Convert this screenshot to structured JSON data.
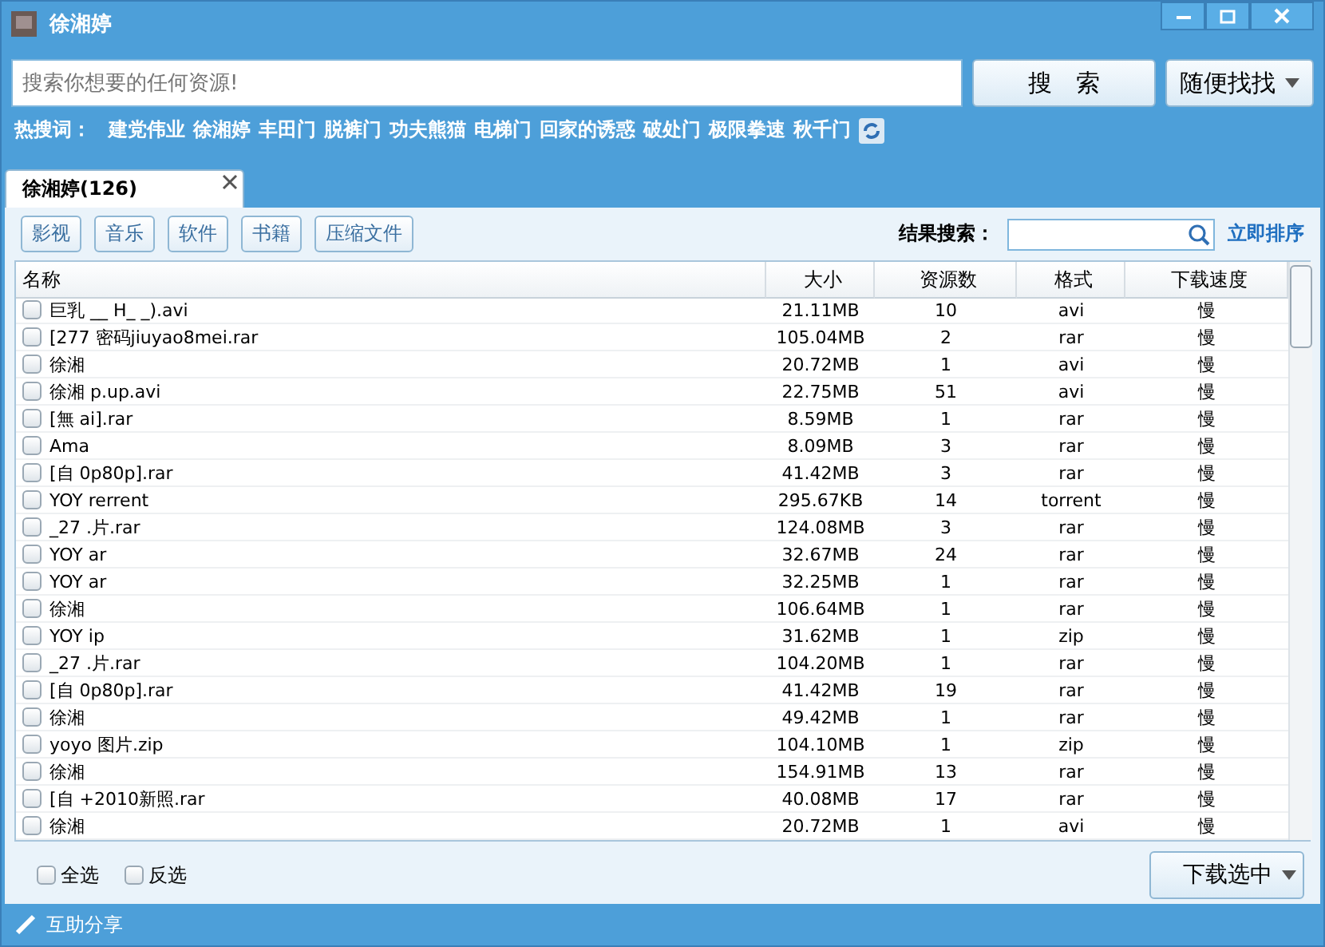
{
  "window": {
    "title": "徐湘婷"
  },
  "search": {
    "placeholder": "搜索你想要的任何资源!",
    "button": "搜　索",
    "random_button": "随便找找"
  },
  "hot_words": {
    "label": "热搜词：",
    "items": [
      "建党伟业",
      "徐湘婷",
      "丰田门",
      "脱裤门",
      "功夫熊猫",
      "电梯门",
      "回家的诱惑",
      "破处门",
      "极限拳速",
      "秋千门"
    ]
  },
  "tabs": [
    {
      "label": "徐湘婷(126)",
      "selected": true
    }
  ],
  "categories": [
    "影视",
    "音乐",
    "软件",
    "书籍",
    "压缩文件"
  ],
  "result_search": {
    "label": "结果搜索：",
    "sort_link": "立即排序"
  },
  "table": {
    "columns": [
      "名称",
      "大小",
      "资源数",
      "格式",
      "下载速度"
    ],
    "rows": [
      {
        "name": "巨乳 __ H_ _).avi",
        "size": "21.11MB",
        "count": "10",
        "format": "avi",
        "speed": "慢",
        "checked": false
      },
      {
        "name": "[277 密码jiuyao8mei.rar",
        "size": "105.04MB",
        "count": "2",
        "format": "rar",
        "speed": "慢",
        "checked": false
      },
      {
        "name": "徐湘",
        "size": "20.72MB",
        "count": "1",
        "format": "avi",
        "speed": "慢",
        "checked": false
      },
      {
        "name": "徐湘 p.up.avi",
        "size": "22.75MB",
        "count": "51",
        "format": "avi",
        "speed": "慢",
        "checked": false
      },
      {
        "name": "[無 ai].rar",
        "size": "8.59MB",
        "count": "1",
        "format": "rar",
        "speed": "慢",
        "checked": false
      },
      {
        "name": "Ama",
        "size": "8.09MB",
        "count": "3",
        "format": "rar",
        "speed": "慢",
        "checked": false
      },
      {
        "name": "[自 0p80p].rar",
        "size": "41.42MB",
        "count": "3",
        "format": "rar",
        "speed": "慢",
        "checked": false
      },
      {
        "name": "YOY rerrent",
        "size": "295.67KB",
        "count": "14",
        "format": "torrent",
        "speed": "慢",
        "checked": false
      },
      {
        "name": "_27 .片.rar",
        "size": "124.08MB",
        "count": "3",
        "format": "rar",
        "speed": "慢",
        "checked": false
      },
      {
        "name": "YOY ar",
        "size": "32.67MB",
        "count": "24",
        "format": "rar",
        "speed": "慢",
        "checked": false
      },
      {
        "name": "YOY ar",
        "size": "32.25MB",
        "count": "1",
        "format": "rar",
        "speed": "慢",
        "checked": false
      },
      {
        "name": "徐湘",
        "size": "106.64MB",
        "count": "1",
        "format": "rar",
        "speed": "慢",
        "checked": false
      },
      {
        "name": "YOY ip",
        "size": "31.62MB",
        "count": "1",
        "format": "zip",
        "speed": "慢",
        "checked": false
      },
      {
        "name": "_27 .片.rar",
        "size": "104.20MB",
        "count": "1",
        "format": "rar",
        "speed": "慢",
        "checked": false
      },
      {
        "name": "[自 0p80p].rar",
        "size": "41.42MB",
        "count": "19",
        "format": "rar",
        "speed": "慢",
        "checked": false
      },
      {
        "name": "徐湘",
        "size": "49.42MB",
        "count": "1",
        "format": "rar",
        "speed": "慢",
        "checked": false
      },
      {
        "name": "yoyo 图片.zip",
        "size": "104.10MB",
        "count": "1",
        "format": "zip",
        "speed": "慢",
        "checked": false
      },
      {
        "name": "徐湘",
        "size": "154.91MB",
        "count": "13",
        "format": "rar",
        "speed": "慢",
        "checked": false
      },
      {
        "name": "[自 +2010新照.rar",
        "size": "40.08MB",
        "count": "17",
        "format": "rar",
        "speed": "慢",
        "checked": false
      },
      {
        "name": "徐湘",
        "size": "20.72MB",
        "count": "1",
        "format": "avi",
        "speed": "慢",
        "checked": false
      }
    ]
  },
  "selection": [
    {
      "label": "全选",
      "checked": false
    },
    {
      "label": "反选",
      "checked": false
    }
  ],
  "download_button": "下载选中",
  "status_bar": {
    "text": "互助分享"
  }
}
